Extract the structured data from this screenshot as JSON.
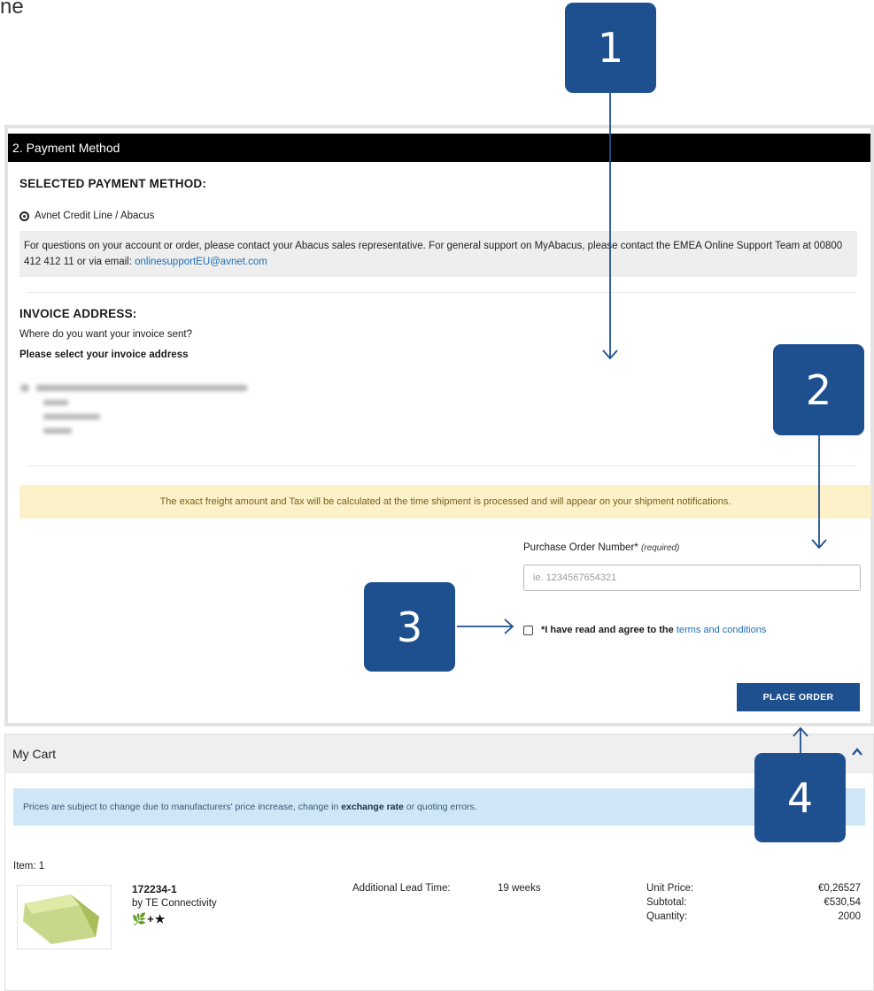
{
  "page_fragment": "ne",
  "payment": {
    "header": "2. Payment Method",
    "selected_title": "SELECTED PAYMENT METHOD:",
    "selected_option": "Avnet Credit Line / Abacus",
    "info_text_1": "For questions on your account or order, please contact your Abacus sales representative. For general support on MyAbacus, please contact the EMEA Online Support Team at 00800 412 412 11 or via email: ",
    "info_email": "onlinesupportEU@avnet.com"
  },
  "invoice": {
    "title": "INVOICE ADDRESS:",
    "question": "Where do you want your invoice sent?",
    "select_label": "Please select your invoice address"
  },
  "freight_notice": "The exact freight amount and Tax will be calculated at the time shipment is processed and will appear on your shipment notifications.",
  "po": {
    "label": "Purchase Order Number*",
    "required": "(required)",
    "placeholder": "ie. 1234567654321"
  },
  "agree": {
    "text": "*I have read and agree to the ",
    "link": "terms and conditions"
  },
  "place_order": "PLACE ORDER",
  "cart": {
    "title": "My Cart",
    "notice_pre": "Prices are subject to change due to manufacturers' price increase, change in ",
    "notice_bold": "exchange rate",
    "notice_post": " or quoting errors.",
    "item_label": "Item: 1",
    "part_number": "172234-1",
    "manufacturer": "by TE Connectivity",
    "icons": "🌿+★",
    "lead_time_label": "Additional Lead Time:",
    "lead_time_value": "19 weeks",
    "unit_price_label": "Unit Price:",
    "unit_price_value": "€0,26527",
    "subtotal_label": "Subtotal:",
    "subtotal_value": "€530,54",
    "quantity_label": "Quantity:",
    "quantity_value": "2000"
  },
  "callouts": [
    "1",
    "2",
    "3",
    "4"
  ],
  "colors": {
    "accent": "#1e5090",
    "header_bg": "#000000",
    "notice_yellow": "#fcf1c8",
    "notice_blue": "#cfe6f7",
    "link": "#1f6fb5"
  }
}
